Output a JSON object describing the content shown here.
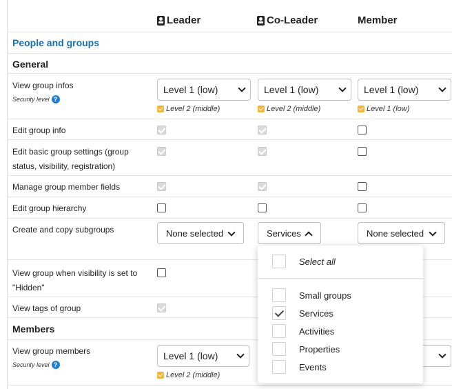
{
  "columns": [
    "Leader",
    "Co-Leader",
    "Member"
  ],
  "section": "People and groups",
  "groups": {
    "general": "General",
    "members": "Members"
  },
  "security_level_label": "Security level",
  "help_glyph": "?",
  "rows": {
    "view_group_infos": {
      "label": "View group infos",
      "selects": [
        "Level 1 (low)",
        "Level 1 (low)",
        "Level 1 (low)"
      ],
      "hints": [
        "Level 2 (middle)",
        "Level 2 (middle)",
        "Level 1 (low)"
      ]
    },
    "edit_group_info": {
      "label": "Edit group info",
      "checks": [
        "checked-disabled",
        "checked-disabled",
        "unchecked"
      ]
    },
    "edit_basic_settings": {
      "label": "Edit basic group settings (group status, visibility, registration)",
      "checks": [
        "checked-disabled",
        "checked-disabled",
        "unchecked"
      ]
    },
    "manage_member_fields": {
      "label": "Manage group member fields",
      "checks": [
        "checked-disabled",
        "checked-disabled",
        "unchecked"
      ]
    },
    "edit_hierarchy": {
      "label": "Edit group hierarchy",
      "checks": [
        "unchecked",
        "unchecked",
        "unchecked"
      ]
    },
    "create_copy_subgroups": {
      "label": "Create and copy subgroups",
      "multiselects": [
        "None selected",
        "Services",
        "None selected"
      ]
    },
    "view_when_hidden": {
      "label": "View group when visibility is set to \"Hidden\"",
      "checks": [
        "unchecked"
      ]
    },
    "view_tags": {
      "label": "View tags of group",
      "checks": [
        "checked-disabled"
      ]
    },
    "view_members": {
      "label": "View group members",
      "selects": [
        "Level 1 (low)"
      ],
      "hints": [
        "Level 2 (middle)"
      ]
    }
  },
  "dropdown": {
    "select_all": "Select all",
    "options": [
      {
        "label": "Small groups",
        "checked": false
      },
      {
        "label": "Services",
        "checked": true
      },
      {
        "label": "Activities",
        "checked": false
      },
      {
        "label": "Properties",
        "checked": false
      },
      {
        "label": "Events",
        "checked": false
      }
    ]
  },
  "colors": {
    "section_title": "#1a6fb0",
    "hint_check": "#f2b63a",
    "help_icon": "#1e7fd4"
  }
}
